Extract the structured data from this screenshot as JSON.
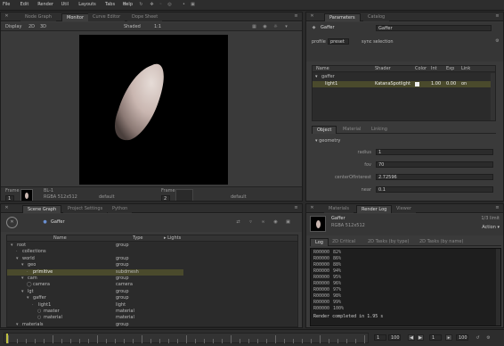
{
  "menubar": {
    "items": [
      "File",
      "Edit",
      "Render",
      "Util",
      "Layouts",
      "Tabs",
      "Help"
    ]
  },
  "viewer_panel": {
    "tabs": [
      "Node Graph",
      "Monitor",
      "Curve Editor",
      "Dope Sheet"
    ],
    "active_tab": "Monitor",
    "toolbar_left": [
      "Display",
      "2D",
      "3D"
    ],
    "toolbar_mid": "Shaded",
    "zoom": "1:1",
    "frame_label": "Frame",
    "frame_value": "1",
    "thumb_label_a": "BL-1",
    "thumb_label_b": "RGBA 512x512",
    "thumb_label_c": "default",
    "frame_b_label": "Frame",
    "frame_b_value": "2"
  },
  "parameters_panel": {
    "tabs": [
      "Parameters",
      "Catalog"
    ],
    "node_name": "Gaffer",
    "node_name_field": "Gaffer",
    "profile_label": "profile",
    "profile_value": "preset",
    "sync_label": "sync selection",
    "table_headers": [
      "Name",
      "Shader",
      "Color",
      "Int",
      "Exp",
      "Link"
    ],
    "group_row": "gaffer",
    "light_row": {
      "name": "light1",
      "shader": "KatanaSpotlight",
      "int": "1.00",
      "exp": "0.00",
      "link": "on"
    },
    "subtabs": [
      "Object",
      "Material",
      "Linking"
    ],
    "section": "geometry",
    "params": [
      {
        "label": "radius",
        "value": "1"
      },
      {
        "label": "fov",
        "value": "70"
      },
      {
        "label": "centerOfInterest",
        "value": "2.72596"
      },
      {
        "label": "near",
        "value": "0.1"
      }
    ]
  },
  "scenegraph_panel": {
    "tabs": [
      "Scene Graph",
      "Project Settings",
      "Python"
    ],
    "active_tab": "Scene Graph",
    "root_label": "Gaffer",
    "columns": [
      "Name",
      "Type",
      "Lights"
    ],
    "rows": [
      {
        "name": "root",
        "type": "group",
        "indent": 0
      },
      {
        "name": "collections",
        "type": "",
        "indent": 1
      },
      {
        "name": "world",
        "type": "group",
        "indent": 1
      },
      {
        "name": "geo",
        "type": "group",
        "indent": 2
      },
      {
        "name": "primitive",
        "type": "subdmesh",
        "indent": 3,
        "selected": true
      },
      {
        "name": "cam",
        "type": "group",
        "indent": 2
      },
      {
        "name": "camera",
        "type": "camera",
        "indent": 3
      },
      {
        "name": "lgt",
        "type": "group",
        "indent": 2
      },
      {
        "name": "gaffer",
        "type": "group",
        "indent": 3
      },
      {
        "name": "light1",
        "type": "light",
        "indent": 4
      },
      {
        "name": "master",
        "type": "material",
        "indent": 5
      },
      {
        "name": "material",
        "type": "material",
        "indent": 5
      },
      {
        "name": "materials",
        "type": "group",
        "indent": 1
      }
    ]
  },
  "renderlog_panel": {
    "tabs": [
      "Materials",
      "Render Log",
      "Viewer"
    ],
    "active_tab": "Render Log",
    "render_name": "Gaffer",
    "render_info": "RGBA 512x512",
    "render_count": "1/3 limit",
    "action": "Action",
    "subtabs": [
      "Log",
      "2D Critical",
      "2D Tasks (by type)",
      "2D Tasks (by name)"
    ],
    "log_lines": [
      {
        "code": "R00000",
        "pct": "82%"
      },
      {
        "code": "R00000",
        "pct": "86%"
      },
      {
        "code": "R00000",
        "pct": "88%"
      },
      {
        "code": "R00000",
        "pct": "94%"
      },
      {
        "code": "R00000",
        "pct": "95%"
      },
      {
        "code": "R00000",
        "pct": "96%"
      },
      {
        "code": "R00000",
        "pct": "97%"
      },
      {
        "code": "R00000",
        "pct": "98%"
      },
      {
        "code": "R00000",
        "pct": "99%"
      },
      {
        "code": "R00000",
        "pct": "100%"
      }
    ],
    "completed": "Render completed in 1.95 s"
  },
  "timeline": {
    "start": "1",
    "end": "100",
    "current": "1",
    "in": "1",
    "out": "100"
  },
  "colors": {
    "accent_select": "#5a5a2a",
    "light_row": "#4a4a2c",
    "background": "#2a2a2a"
  }
}
